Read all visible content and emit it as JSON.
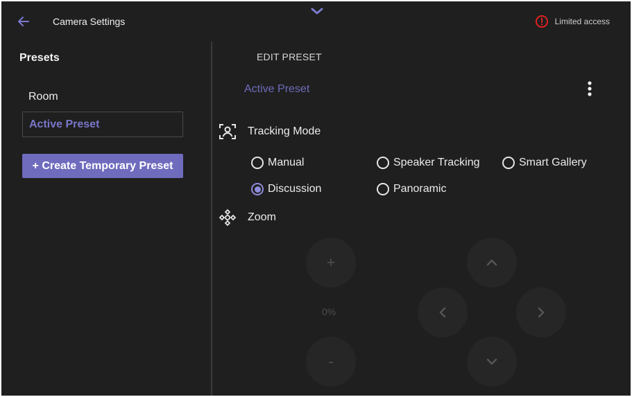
{
  "header": {
    "title": "Camera Settings",
    "status": "Limited access"
  },
  "presets": {
    "title": "Presets",
    "items": [
      {
        "label": "Room",
        "selected": false
      },
      {
        "label": "Active Preset",
        "selected": true
      }
    ],
    "create_button": "+ Create Temporary Preset"
  },
  "edit": {
    "title": "EDIT PRESET",
    "preset_name": "Active Preset",
    "tracking": {
      "title": "Tracking Mode",
      "options": [
        {
          "label": "Manual",
          "selected": false
        },
        {
          "label": "Speaker Tracking",
          "selected": false
        },
        {
          "label": "Smart Gallery",
          "selected": false
        },
        {
          "label": "Discussion",
          "selected": true
        },
        {
          "label": "Panoramic",
          "selected": false
        }
      ]
    },
    "zoom": {
      "title": "Zoom",
      "value": "0%",
      "in_label": "+",
      "out_label": "-"
    }
  },
  "colors": {
    "accent": "#6f6bbd",
    "background": "#1f1f1f",
    "alert": "#e02020"
  },
  "icons": [
    "arrow-left-icon",
    "chevron-down-icon",
    "alert-circle-icon",
    "more-vertical-icon",
    "tracking-mode-icon",
    "zoom-icon",
    "chevron-up-icon",
    "chevron-left-icon",
    "chevron-right-icon"
  ]
}
